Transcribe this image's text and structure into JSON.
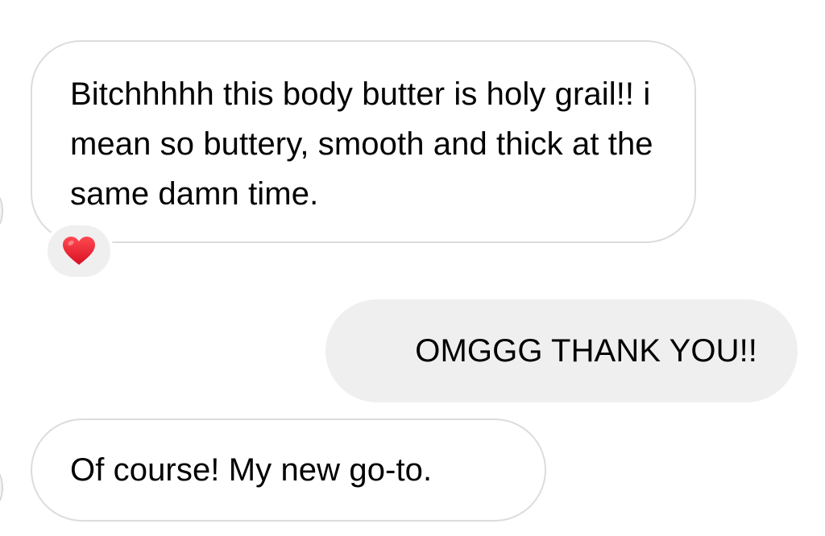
{
  "conversation": {
    "messages": [
      {
        "direction": "incoming",
        "text": "Bitchhhhh this body butter is holy grail!! i mean so buttery, smooth and thick at the same damn time.",
        "reaction": "heart-icon"
      },
      {
        "direction": "outgoing",
        "text": "OMGGG THANK YOU!!"
      },
      {
        "direction": "incoming",
        "text": "Of course! My new go-to."
      }
    ]
  },
  "colors": {
    "incoming_bubble_bg": "#ffffff",
    "incoming_bubble_border": "#dcdcdc",
    "outgoing_bubble_bg": "#efefef",
    "reaction_bg": "#efefef",
    "heart": "#e8182b",
    "text": "#000000"
  }
}
